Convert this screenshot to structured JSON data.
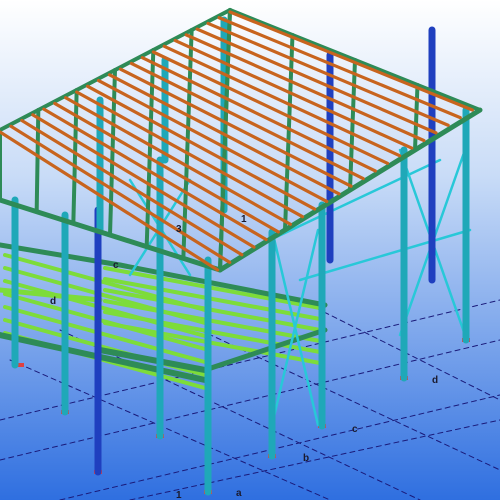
{
  "viewport": {
    "background_top": "#ffffff",
    "background_bottom": "#2f6fe0",
    "colors": {
      "column": "#1fa8b8",
      "column_dark": "#1f3fbf",
      "rafter": "#2e8b57",
      "purlin": "#c8641e",
      "floor_beam": "#7ddc3a",
      "brace": "#28c8d8",
      "gridline": "#1a1a7a",
      "base": "#e04040"
    }
  },
  "grid_labels": {
    "roof_1": "1",
    "roof_3": "3",
    "mezz_c": "c",
    "mezz_d": "d",
    "axis_a": "a",
    "axis_b": "b",
    "axis_c": "c",
    "axis_d": "d",
    "axis_1": "1"
  }
}
